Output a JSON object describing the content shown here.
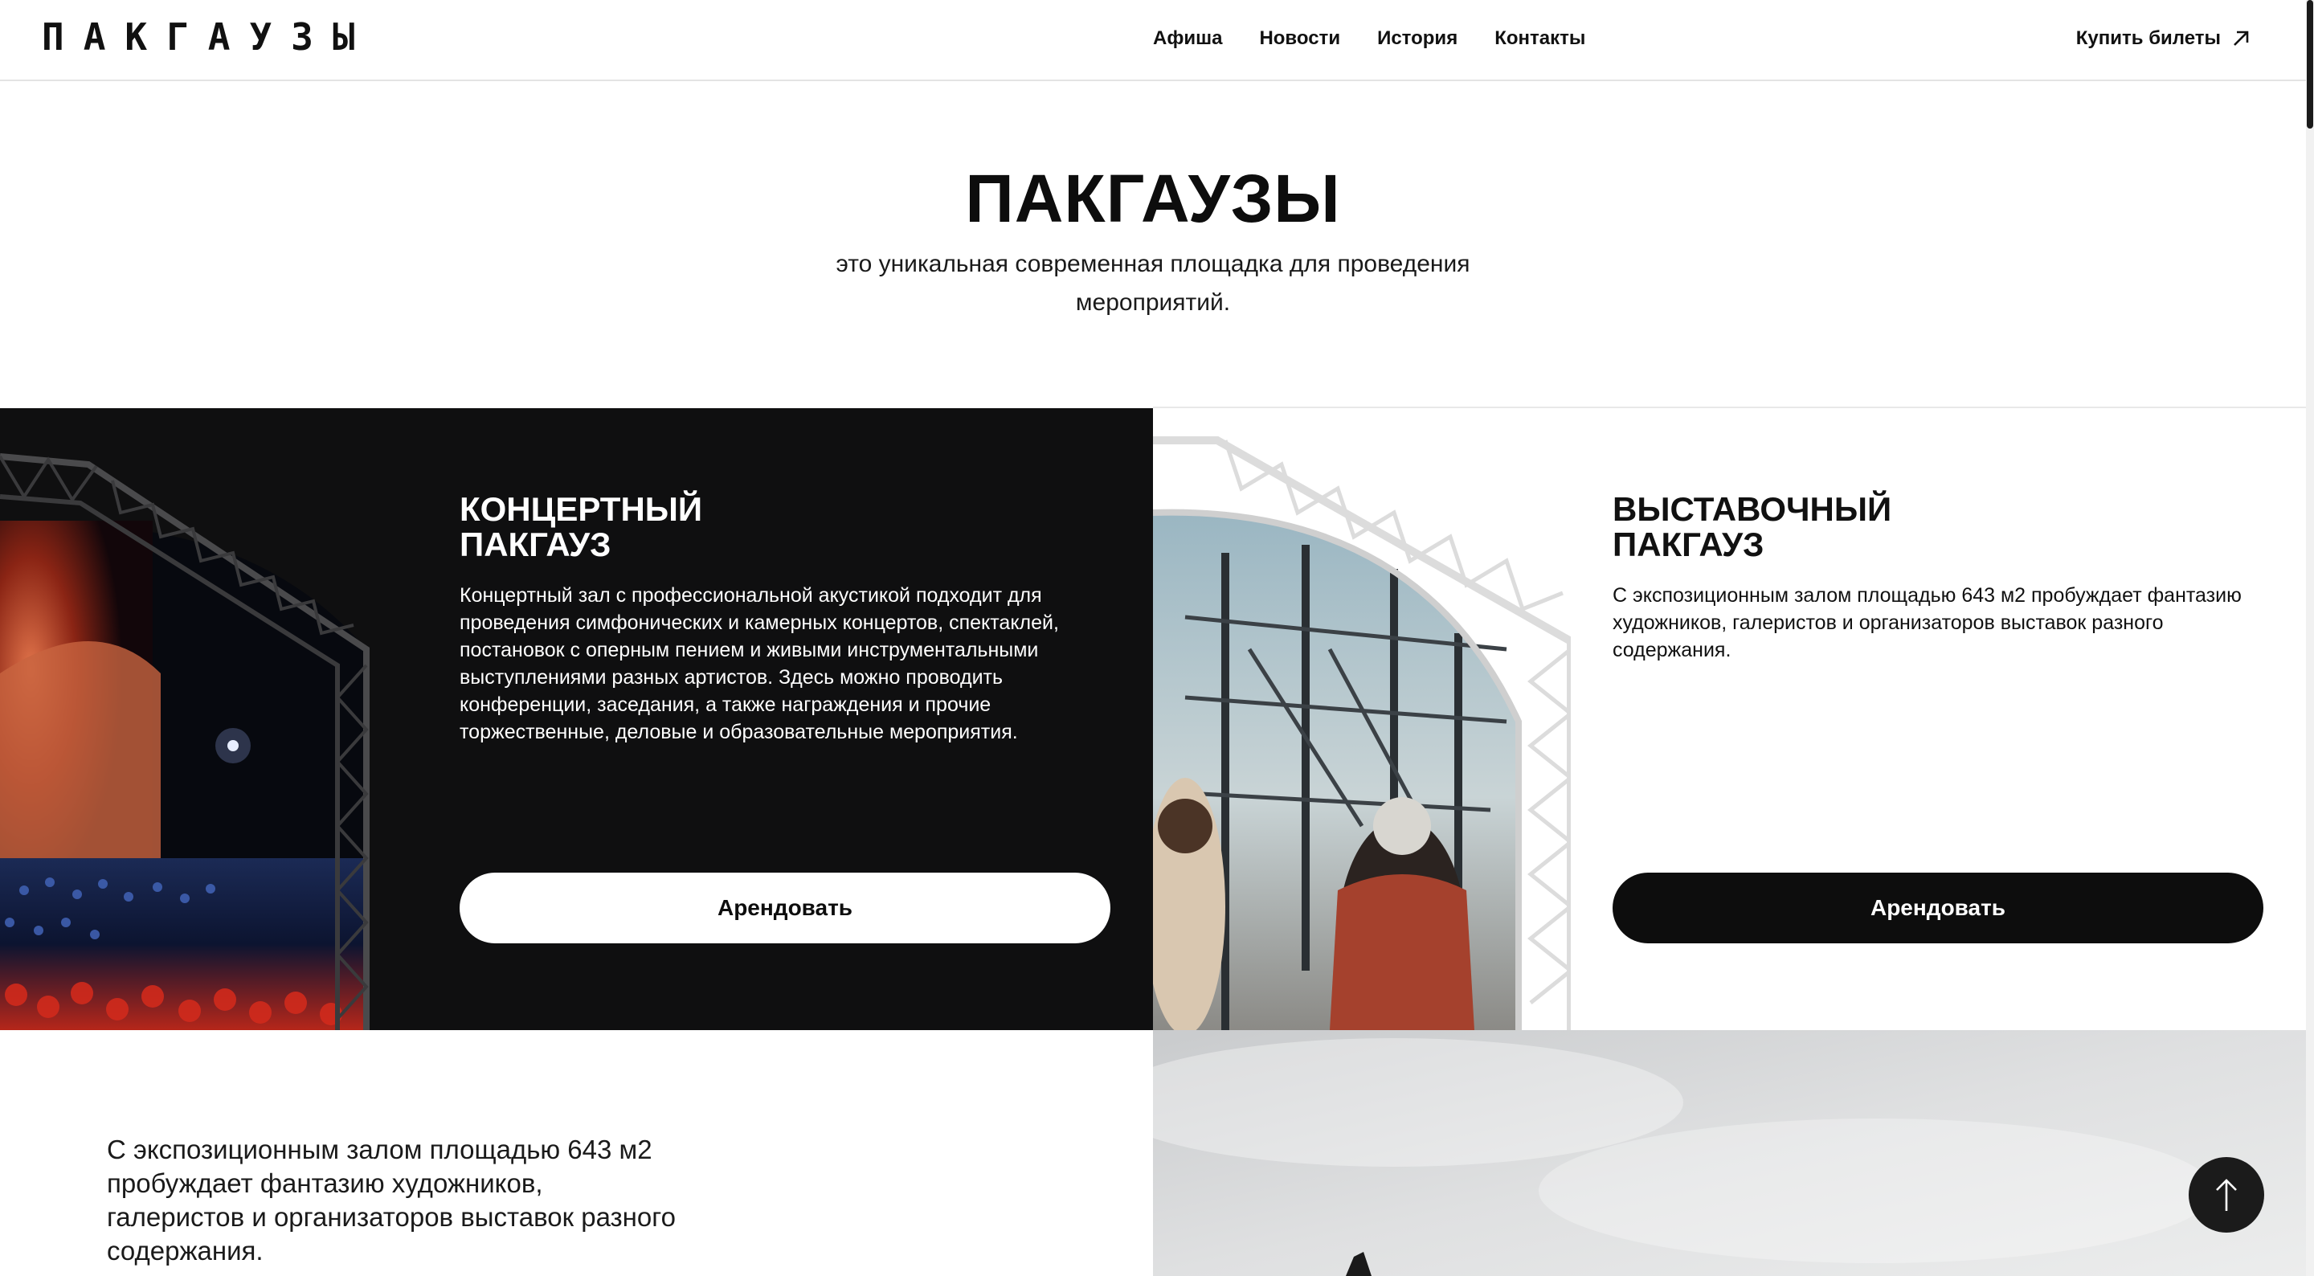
{
  "header": {
    "logo": "ПАКГАУЗЫ",
    "nav": [
      "Афиша",
      "Новости",
      "История",
      "Контакты"
    ],
    "buy_label": "Купить билеты"
  },
  "hero": {
    "title": "ПАКГАУЗЫ",
    "subtitle": "это уникальная современная площадка для проведения мероприятий."
  },
  "cards": [
    {
      "title_line1": "КОНЦЕРТНЫЙ",
      "title_line2": "ПАКГАУЗ",
      "text": "Концертный зал с профессиональной акустикой подходит для проведения симфонических и камерных концертов, спектаклей, постановок с оперным пением и живыми инструментальными выступлениями разных артистов. Здесь можно проводить конференции, заседания,  а также награждения и прочие торжественные, деловые и образовательные мероприятия.",
      "button": "Арендовать"
    },
    {
      "title_line1": "ВЫСТАВОЧНЫЙ",
      "title_line2": "ПАКГАУЗ",
      "text": "С экспозиционным залом площадью 643 м2 пробуждает фантазию художников, галеристов и организаторов выставок разного содержания.",
      "button": "Арендовать"
    }
  ],
  "bottom": {
    "text": "С экспозиционным залом площадью 643 м2 пробуждает фантазию художников, галеристов и организаторов выставок разного содержания."
  },
  "icons": {
    "buy": "arrow-up-right-icon",
    "to_top": "arrow-up-icon"
  },
  "colors": {
    "dark": "#0f0f10",
    "light": "#ffffff",
    "accent_red": "#c63a1e"
  }
}
